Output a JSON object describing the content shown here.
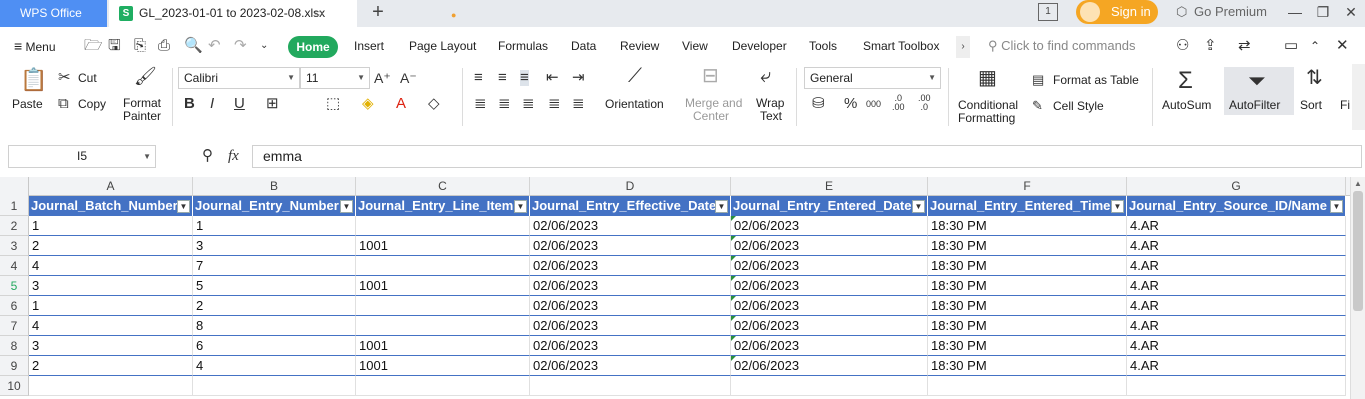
{
  "app": {
    "name": "WPS Office"
  },
  "file_tab": {
    "title": "GL_2023-01-01 to 2023-02-08.xlsx",
    "icon": "spreadsheet-icon",
    "modified_dot": "●"
  },
  "titlebar": {
    "add_tab": "+",
    "signin": "Sign in",
    "premium": "Go Premium"
  },
  "menu": {
    "menu_label": "Menu",
    "tabs": [
      "Home",
      "Insert",
      "Page Layout",
      "Formulas",
      "Data",
      "Review",
      "View",
      "Developer",
      "Tools",
      "Smart Toolbox"
    ],
    "search": "Click to find commands"
  },
  "ribbon": {
    "paste": "Paste",
    "cut": "Cut",
    "copy": "Copy",
    "format_painter_1": "Format",
    "format_painter_2": "Painter",
    "font_name": "Calibri",
    "font_size": "11",
    "bold": "B",
    "italic": "I",
    "underline": "U",
    "font_color_letter": "A",
    "orientation": "Orientation",
    "merge_1": "Merge and",
    "merge_2": "Center",
    "wrap_1": "Wrap",
    "wrap_2": "Text",
    "number_format": "General",
    "percent": "%",
    "thousands": "000",
    "conditional_1": "Conditional",
    "conditional_2": "Formatting",
    "format_as_table": "Format as Table",
    "cell_style": "Cell Style",
    "autosum": "AutoSum",
    "autofilter": "AutoFilter",
    "sort": "Sort",
    "fill": "Fi"
  },
  "formula_bar": {
    "cell_ref": "I5",
    "fx": "fx",
    "value": "emma"
  },
  "columns": [
    "A",
    "B",
    "C",
    "D",
    "E",
    "F",
    "G"
  ],
  "rows": [
    "1",
    "2",
    "3",
    "4",
    "5",
    "6",
    "7",
    "8",
    "9",
    "10"
  ],
  "headers": [
    "Journal_Batch_Number",
    "Journal_Entry_Number",
    "Journal_Entry_Line_Item",
    "Journal_Entry_Effective_Date",
    "Journal_Entry_Entered_Date",
    "Journal_Entry_Entered_Time",
    "Journal_Entry_Source_ID/Name"
  ],
  "data_rows": [
    [
      "1",
      "1",
      "",
      "02/06/2023",
      "02/06/2023",
      "18:30 PM",
      "4.AR"
    ],
    [
      "2",
      "3",
      "1001",
      "02/06/2023",
      "02/06/2023",
      "18:30 PM",
      "4.AR"
    ],
    [
      "4",
      "7",
      "",
      "02/06/2023",
      "02/06/2023",
      "18:30 PM",
      "4.AR"
    ],
    [
      "3",
      "5",
      "1001",
      "02/06/2023",
      "02/06/2023",
      "18:30 PM",
      "4.AR"
    ],
    [
      "1",
      "2",
      "",
      "02/06/2023",
      "02/06/2023",
      "18:30 PM",
      "4.AR"
    ],
    [
      "4",
      "8",
      "",
      "02/06/2023",
      "02/06/2023",
      "18:30 PM",
      "4.AR"
    ],
    [
      "3",
      "6",
      "1001",
      "02/06/2023",
      "02/06/2023",
      "18:30 PM",
      "4.AR"
    ],
    [
      "2",
      "4",
      "1001",
      "02/06/2023",
      "02/06/2023",
      "18:30 PM",
      "4.AR"
    ]
  ],
  "colors": {
    "header_fill": "#4472c4",
    "home_tab": "#22a95e",
    "app_tab": "#4f8ff3",
    "signin": "#f5a623"
  }
}
